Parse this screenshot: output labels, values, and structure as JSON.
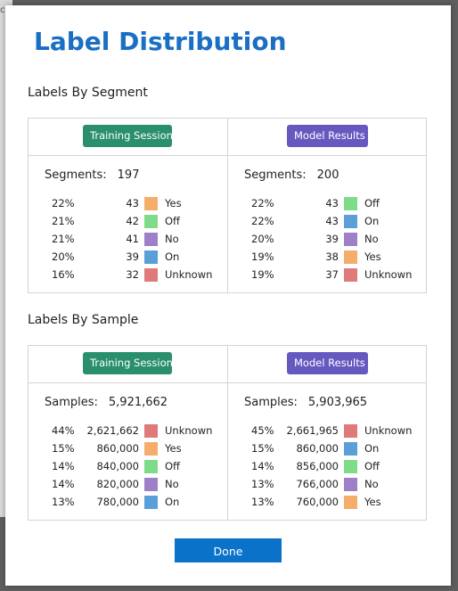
{
  "dialog": {
    "title": "Label Distribution",
    "done_label": "Done"
  },
  "sections": [
    {
      "title": "Labels By Segment",
      "count_label": "Segments:",
      "left": {
        "header": "Training Session",
        "count": "197",
        "rows": [
          {
            "pct": "22%",
            "value": "43",
            "label": "Yes",
            "color": "#f5ad6c"
          },
          {
            "pct": "21%",
            "value": "42",
            "label": "Off",
            "color": "#7edc88"
          },
          {
            "pct": "21%",
            "value": "41",
            "label": "No",
            "color": "#9d80c8"
          },
          {
            "pct": "20%",
            "value": "39",
            "label": "On",
            "color": "#5a9fd8"
          },
          {
            "pct": "16%",
            "value": "32",
            "label": "Unknown",
            "color": "#e07a7a"
          }
        ]
      },
      "right": {
        "header": "Model Results",
        "count": "200",
        "rows": [
          {
            "pct": "22%",
            "value": "43",
            "label": "Off",
            "color": "#7edc88"
          },
          {
            "pct": "22%",
            "value": "43",
            "label": "On",
            "color": "#5a9fd8"
          },
          {
            "pct": "20%",
            "value": "39",
            "label": "No",
            "color": "#9d80c8"
          },
          {
            "pct": "19%",
            "value": "38",
            "label": "Yes",
            "color": "#f5ad6c"
          },
          {
            "pct": "19%",
            "value": "37",
            "label": "Unknown",
            "color": "#e07a7a"
          }
        ]
      }
    },
    {
      "title": "Labels By Sample",
      "count_label": "Samples:",
      "left": {
        "header": "Training Session",
        "count": "5,921,662",
        "rows": [
          {
            "pct": "44%",
            "value": "2,621,662",
            "label": "Unknown",
            "color": "#e07a7a"
          },
          {
            "pct": "15%",
            "value": "860,000",
            "label": "Yes",
            "color": "#f5ad6c"
          },
          {
            "pct": "14%",
            "value": "840,000",
            "label": "Off",
            "color": "#7edc88"
          },
          {
            "pct": "14%",
            "value": "820,000",
            "label": "No",
            "color": "#9d80c8"
          },
          {
            "pct": "13%",
            "value": "780,000",
            "label": "On",
            "color": "#5a9fd8"
          }
        ]
      },
      "right": {
        "header": "Model Results",
        "count": "5,903,965",
        "rows": [
          {
            "pct": "45%",
            "value": "2,661,965",
            "label": "Unknown",
            "color": "#e07a7a"
          },
          {
            "pct": "15%",
            "value": "860,000",
            "label": "On",
            "color": "#5a9fd8"
          },
          {
            "pct": "14%",
            "value": "856,000",
            "label": "Off",
            "color": "#7edc88"
          },
          {
            "pct": "13%",
            "value": "766,000",
            "label": "No",
            "color": "#9d80c8"
          },
          {
            "pct": "13%",
            "value": "760,000",
            "label": "Yes",
            "color": "#f5ad6c"
          }
        ]
      }
    }
  ]
}
